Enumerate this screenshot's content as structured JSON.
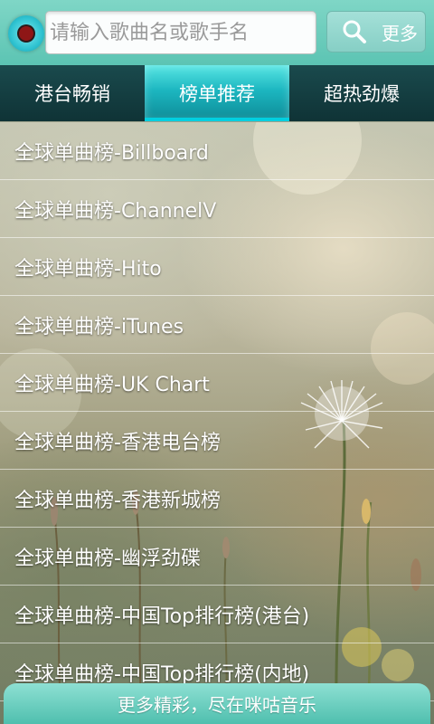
{
  "search": {
    "placeholder": "请输入歌曲名或歌手名",
    "value": "",
    "button_label": "更多"
  },
  "tabs": [
    {
      "label": "港台畅销",
      "active": false
    },
    {
      "label": "榜单推荐",
      "active": true
    },
    {
      "label": "超热劲爆",
      "active": false
    }
  ],
  "chart_list": [
    {
      "label": "全球单曲榜-Billboard"
    },
    {
      "label": "全球单曲榜-ChannelV"
    },
    {
      "label": "全球单曲榜-Hito"
    },
    {
      "label": "全球单曲榜-iTunes"
    },
    {
      "label": "全球单曲榜-UK Chart"
    },
    {
      "label": "全球单曲榜-香港电台榜"
    },
    {
      "label": "全球单曲榜-香港新城榜"
    },
    {
      "label": "全球单曲榜-幽浮劲碟"
    },
    {
      "label": "全球单曲榜-中国Top排行榜(港台)"
    },
    {
      "label": "全球单曲榜-中国Top排行榜(内地)"
    }
  ],
  "footer": {
    "text": "更多精彩，尽在咪咕音乐"
  },
  "colors": {
    "accent": "#5cc4b3",
    "tab_bar": "#0f3336",
    "tab_active": "#1cb6c0",
    "logo_center": "#8e1616"
  }
}
